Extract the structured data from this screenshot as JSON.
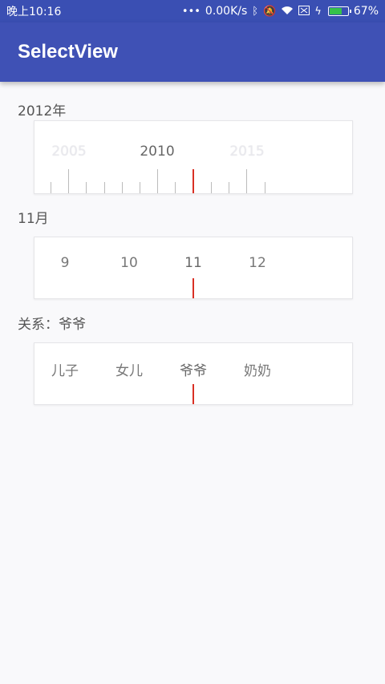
{
  "status_bar": {
    "time": "晚上10:16",
    "network_speed": "0.00K/s",
    "battery_percent": "67%",
    "battery_level": 0.67,
    "icons": [
      "dots-icon",
      "bluetooth-icon",
      "mute-icon",
      "wifi-icon",
      "sim-icon",
      "charging-icon",
      "battery-icon"
    ]
  },
  "app_bar": {
    "title": "SelectView"
  },
  "year_picker": {
    "label": "2012年",
    "major_labels": [
      "2005",
      "2010",
      "2015"
    ],
    "selected": "2010"
  },
  "month_picker": {
    "label": "11月",
    "options": [
      "9",
      "10",
      "11",
      "12"
    ],
    "selected": "11"
  },
  "relation_picker": {
    "label": "关系：爷爷",
    "options": [
      "儿子",
      "女儿",
      "爷爷",
      "奶奶"
    ],
    "selected": "爷爷"
  },
  "colors": {
    "status_bar": "#3a4fb3",
    "app_bar": "#3f51b5",
    "indicator": "#d93025",
    "background": "#f9f9fb"
  }
}
